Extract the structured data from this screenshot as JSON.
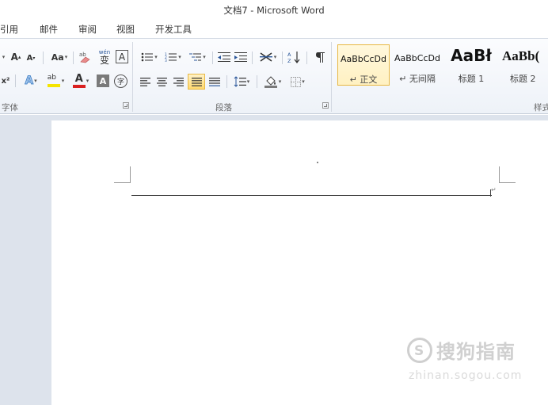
{
  "window": {
    "title": "文档7 - Microsoft Word"
  },
  "tabs": [
    "引用",
    "邮件",
    "审阅",
    "视图",
    "开发工具"
  ],
  "ribbon": {
    "font_group_label": "字体",
    "paragraph_group_label": "段落",
    "styles_group_label": "样式",
    "font": {
      "grow_label": "A",
      "shrink_label": "A",
      "change_case_label": "Aa",
      "phonetic_label": "wén",
      "phonetic_char": "变",
      "char_border_label": "A",
      "superscript_label": "x²",
      "text_effect_label": "A",
      "highlight_label": "ab",
      "font_color_label": "A",
      "char_shading_label": "A",
      "enclose_char_label": "字",
      "font_color": "#d92020",
      "highlight_color": "#f5e400"
    },
    "styles": [
      {
        "sample": "AaBbCcDd",
        "name": "↵ 正文",
        "selected": true
      },
      {
        "sample": "AaBbCcDd",
        "name": "↵ 无间隔",
        "selected": false
      },
      {
        "sample": "AaBł",
        "name": "标题 1",
        "selected": false
      },
      {
        "sample": "AaBb(",
        "name": "标题 2",
        "selected": false
      }
    ]
  },
  "watermark": {
    "brand": "搜狗指南",
    "url": "zhinan.sogou.com"
  },
  "colors": {
    "accent": "#2b579a",
    "selected_border": "#e8b843",
    "doc_bg": "#dde3ec"
  }
}
